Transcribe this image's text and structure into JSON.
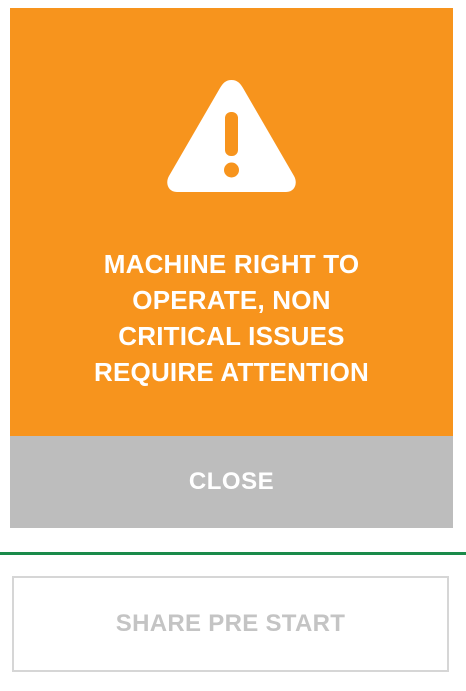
{
  "dialog": {
    "icon": "warning-triangle-icon",
    "background_color": "#f7941d",
    "message_lines": [
      "MACHINE RIGHT TO",
      "OPERATE, NON",
      "CRITICAL ISSUES",
      "REQUIRE ATTENTION"
    ],
    "close_label": "CLOSE"
  },
  "footer": {
    "divider_color": "#1a8a4a",
    "share_label": "SHARE PRE START"
  }
}
